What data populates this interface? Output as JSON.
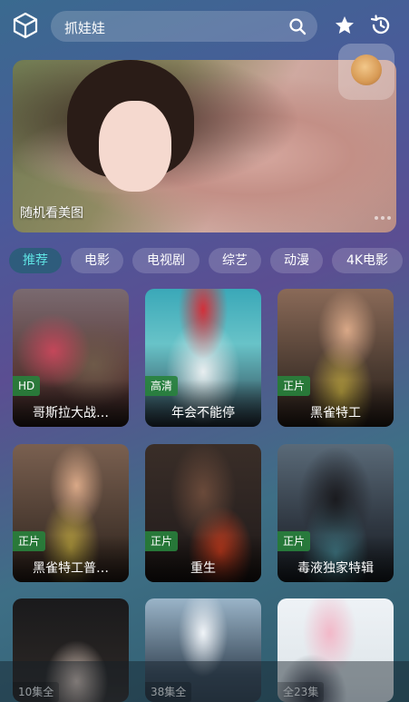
{
  "search": {
    "value": "抓娃娃"
  },
  "icons": {
    "logo": "cube-icon",
    "search": "search-icon",
    "favorites": "star-icon",
    "history": "history-icon"
  },
  "banner": {
    "caption": "随机看美图"
  },
  "tabs": [
    {
      "label": "推荐",
      "active": true
    },
    {
      "label": "电影",
      "active": false
    },
    {
      "label": "电视剧",
      "active": false
    },
    {
      "label": "综艺",
      "active": false
    },
    {
      "label": "动漫",
      "active": false
    },
    {
      "label": "4K电影",
      "active": false
    }
  ],
  "cards": [
    {
      "title": "哥斯拉大战…",
      "badge": "HD"
    },
    {
      "title": "年会不能停",
      "badge": "高清"
    },
    {
      "title": "黑雀特工",
      "badge": "正片"
    },
    {
      "title": "黑雀特工普…",
      "badge": "正片"
    },
    {
      "title": "重生",
      "badge": "正片"
    },
    {
      "title": "毒液独家特辑",
      "badge": "正片"
    },
    {
      "title": "",
      "badge": "10集全"
    },
    {
      "title": "",
      "badge": "38集全"
    },
    {
      "title": "",
      "badge": "全23集"
    }
  ],
  "colors": {
    "active_tab_text": "#5fe3e3",
    "badge_bg": "#28823c"
  }
}
